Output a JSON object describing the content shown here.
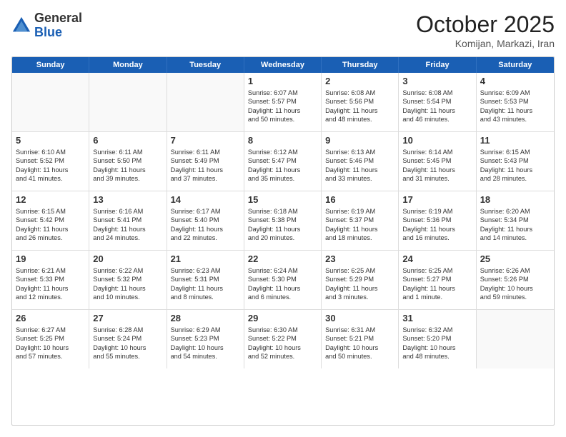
{
  "header": {
    "logo_general": "General",
    "logo_blue": "Blue",
    "month_title": "October 2025",
    "location": "Komijan, Markazi, Iran"
  },
  "weekdays": [
    "Sunday",
    "Monday",
    "Tuesday",
    "Wednesday",
    "Thursday",
    "Friday",
    "Saturday"
  ],
  "rows": [
    [
      {
        "day": "",
        "lines": []
      },
      {
        "day": "",
        "lines": []
      },
      {
        "day": "",
        "lines": []
      },
      {
        "day": "1",
        "lines": [
          "Sunrise: 6:07 AM",
          "Sunset: 5:57 PM",
          "Daylight: 11 hours",
          "and 50 minutes."
        ]
      },
      {
        "day": "2",
        "lines": [
          "Sunrise: 6:08 AM",
          "Sunset: 5:56 PM",
          "Daylight: 11 hours",
          "and 48 minutes."
        ]
      },
      {
        "day": "3",
        "lines": [
          "Sunrise: 6:08 AM",
          "Sunset: 5:54 PM",
          "Daylight: 11 hours",
          "and 46 minutes."
        ]
      },
      {
        "day": "4",
        "lines": [
          "Sunrise: 6:09 AM",
          "Sunset: 5:53 PM",
          "Daylight: 11 hours",
          "and 43 minutes."
        ]
      }
    ],
    [
      {
        "day": "5",
        "lines": [
          "Sunrise: 6:10 AM",
          "Sunset: 5:52 PM",
          "Daylight: 11 hours",
          "and 41 minutes."
        ]
      },
      {
        "day": "6",
        "lines": [
          "Sunrise: 6:11 AM",
          "Sunset: 5:50 PM",
          "Daylight: 11 hours",
          "and 39 minutes."
        ]
      },
      {
        "day": "7",
        "lines": [
          "Sunrise: 6:11 AM",
          "Sunset: 5:49 PM",
          "Daylight: 11 hours",
          "and 37 minutes."
        ]
      },
      {
        "day": "8",
        "lines": [
          "Sunrise: 6:12 AM",
          "Sunset: 5:47 PM",
          "Daylight: 11 hours",
          "and 35 minutes."
        ]
      },
      {
        "day": "9",
        "lines": [
          "Sunrise: 6:13 AM",
          "Sunset: 5:46 PM",
          "Daylight: 11 hours",
          "and 33 minutes."
        ]
      },
      {
        "day": "10",
        "lines": [
          "Sunrise: 6:14 AM",
          "Sunset: 5:45 PM",
          "Daylight: 11 hours",
          "and 31 minutes."
        ]
      },
      {
        "day": "11",
        "lines": [
          "Sunrise: 6:15 AM",
          "Sunset: 5:43 PM",
          "Daylight: 11 hours",
          "and 28 minutes."
        ]
      }
    ],
    [
      {
        "day": "12",
        "lines": [
          "Sunrise: 6:15 AM",
          "Sunset: 5:42 PM",
          "Daylight: 11 hours",
          "and 26 minutes."
        ]
      },
      {
        "day": "13",
        "lines": [
          "Sunrise: 6:16 AM",
          "Sunset: 5:41 PM",
          "Daylight: 11 hours",
          "and 24 minutes."
        ]
      },
      {
        "day": "14",
        "lines": [
          "Sunrise: 6:17 AM",
          "Sunset: 5:40 PM",
          "Daylight: 11 hours",
          "and 22 minutes."
        ]
      },
      {
        "day": "15",
        "lines": [
          "Sunrise: 6:18 AM",
          "Sunset: 5:38 PM",
          "Daylight: 11 hours",
          "and 20 minutes."
        ]
      },
      {
        "day": "16",
        "lines": [
          "Sunrise: 6:19 AM",
          "Sunset: 5:37 PM",
          "Daylight: 11 hours",
          "and 18 minutes."
        ]
      },
      {
        "day": "17",
        "lines": [
          "Sunrise: 6:19 AM",
          "Sunset: 5:36 PM",
          "Daylight: 11 hours",
          "and 16 minutes."
        ]
      },
      {
        "day": "18",
        "lines": [
          "Sunrise: 6:20 AM",
          "Sunset: 5:34 PM",
          "Daylight: 11 hours",
          "and 14 minutes."
        ]
      }
    ],
    [
      {
        "day": "19",
        "lines": [
          "Sunrise: 6:21 AM",
          "Sunset: 5:33 PM",
          "Daylight: 11 hours",
          "and 12 minutes."
        ]
      },
      {
        "day": "20",
        "lines": [
          "Sunrise: 6:22 AM",
          "Sunset: 5:32 PM",
          "Daylight: 11 hours",
          "and 10 minutes."
        ]
      },
      {
        "day": "21",
        "lines": [
          "Sunrise: 6:23 AM",
          "Sunset: 5:31 PM",
          "Daylight: 11 hours",
          "and 8 minutes."
        ]
      },
      {
        "day": "22",
        "lines": [
          "Sunrise: 6:24 AM",
          "Sunset: 5:30 PM",
          "Daylight: 11 hours",
          "and 6 minutes."
        ]
      },
      {
        "day": "23",
        "lines": [
          "Sunrise: 6:25 AM",
          "Sunset: 5:29 PM",
          "Daylight: 11 hours",
          "and 3 minutes."
        ]
      },
      {
        "day": "24",
        "lines": [
          "Sunrise: 6:25 AM",
          "Sunset: 5:27 PM",
          "Daylight: 11 hours",
          "and 1 minute."
        ]
      },
      {
        "day": "25",
        "lines": [
          "Sunrise: 6:26 AM",
          "Sunset: 5:26 PM",
          "Daylight: 10 hours",
          "and 59 minutes."
        ]
      }
    ],
    [
      {
        "day": "26",
        "lines": [
          "Sunrise: 6:27 AM",
          "Sunset: 5:25 PM",
          "Daylight: 10 hours",
          "and 57 minutes."
        ]
      },
      {
        "day": "27",
        "lines": [
          "Sunrise: 6:28 AM",
          "Sunset: 5:24 PM",
          "Daylight: 10 hours",
          "and 55 minutes."
        ]
      },
      {
        "day": "28",
        "lines": [
          "Sunrise: 6:29 AM",
          "Sunset: 5:23 PM",
          "Daylight: 10 hours",
          "and 54 minutes."
        ]
      },
      {
        "day": "29",
        "lines": [
          "Sunrise: 6:30 AM",
          "Sunset: 5:22 PM",
          "Daylight: 10 hours",
          "and 52 minutes."
        ]
      },
      {
        "day": "30",
        "lines": [
          "Sunrise: 6:31 AM",
          "Sunset: 5:21 PM",
          "Daylight: 10 hours",
          "and 50 minutes."
        ]
      },
      {
        "day": "31",
        "lines": [
          "Sunrise: 6:32 AM",
          "Sunset: 5:20 PM",
          "Daylight: 10 hours",
          "and 48 minutes."
        ]
      },
      {
        "day": "",
        "lines": []
      }
    ]
  ]
}
